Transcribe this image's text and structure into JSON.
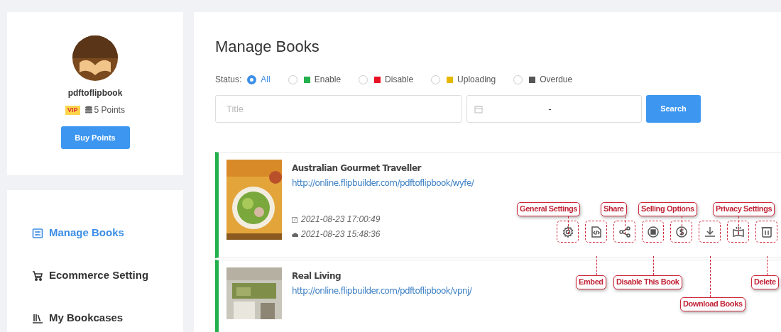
{
  "profile": {
    "username": "pdftoflipbook",
    "badge": "VIP",
    "points": "5 Points",
    "button": "Buy Points"
  },
  "nav": [
    {
      "label": "Manage Books",
      "selected": true
    },
    {
      "label": "Ecommerce Setting",
      "selected": false
    },
    {
      "label": "My Bookcases",
      "selected": false
    }
  ],
  "page_title": "Manage Books",
  "status_filter": {
    "label": "Status:",
    "options": [
      {
        "label": "All",
        "selected": true
      },
      {
        "label": "Enable",
        "color": "#22b14c",
        "selected": false
      },
      {
        "label": "Disable",
        "color": "#e81123",
        "selected": false
      },
      {
        "label": "Uploading",
        "color": "#e6b800",
        "selected": false
      },
      {
        "label": "Overdue",
        "color": "#555555",
        "selected": false
      }
    ]
  },
  "search": {
    "title_placeholder": "Title",
    "date_separator": "-",
    "button": "Search"
  },
  "books": [
    {
      "title": "Australian Gourmet Traveller",
      "url": "http://online.flipbuilder.com/pdftoflipbook/wyfe/",
      "edited": "2021-08-23 17:00:49",
      "uploaded": "2021-08-23 15:48:36",
      "color": "#22b14c"
    },
    {
      "title": "Real Living",
      "url": "http://online.flipbuilder.com/pdftoflipbook/vpnj/",
      "color": "#22b14c"
    }
  ],
  "callouts_above": [
    "General Settings",
    "Share",
    "Selling Options",
    "Privacy Settings"
  ],
  "callouts_below": [
    "Embed",
    "Disable This Book",
    "Delete",
    "Download Books"
  ]
}
